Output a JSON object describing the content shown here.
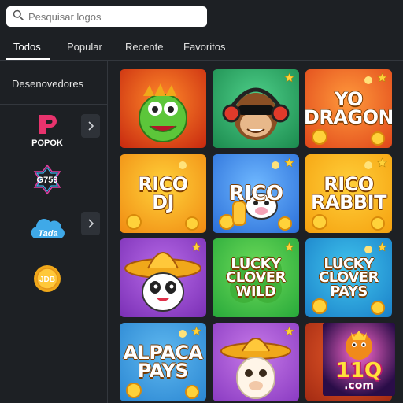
{
  "search": {
    "placeholder": "Pesquisar logos"
  },
  "tabs": [
    {
      "label": "Todos",
      "active": true
    },
    {
      "label": "Popular",
      "active": false
    },
    {
      "label": "Recente",
      "active": false
    },
    {
      "label": "Favoritos",
      "active": false
    }
  ],
  "sidebar": {
    "title": "Desenovedores",
    "providers": [
      {
        "name": "POPOK",
        "icon": "popok-logo"
      },
      {
        "name": "G759",
        "icon": "g759-logo"
      },
      {
        "name": "Tada",
        "icon": "tada-cloud-logo"
      },
      {
        "name": "JDB",
        "icon": "jdb-coin-logo"
      }
    ]
  },
  "games": [
    {
      "title": "",
      "art": "green-dragon",
      "bg": [
        "#ff8a2a",
        "#c7280f"
      ],
      "favorite": false
    },
    {
      "title": "",
      "art": "monkey-headphones",
      "bg": [
        "#4fd08a",
        "#1b8a4e"
      ],
      "favorite": true
    },
    {
      "title": "YO\nDRAGON",
      "art": "coins",
      "bg": [
        "#ff9a3c",
        "#e0461a"
      ],
      "favorite": true
    },
    {
      "title": "RICO\nDJ",
      "art": "coins",
      "bg": [
        "#ffd23a",
        "#f08a12"
      ],
      "favorite": false
    },
    {
      "title": "RICO",
      "art": "cow-coins",
      "bg": [
        "#6fb8ff",
        "#2a6ed8"
      ],
      "favorite": true
    },
    {
      "title": "RICO\nRABBIT",
      "art": "coins",
      "bg": [
        "#ffcf3a",
        "#f5a10f"
      ],
      "favorite": true
    },
    {
      "title": "",
      "art": "panda-sombrero",
      "bg": [
        "#b86be8",
        "#7a2fb5"
      ],
      "favorite": true
    },
    {
      "title": "LUCKY\nCLOVER\nWILD",
      "art": "clover",
      "bg": [
        "#6fdc5a",
        "#27a83a"
      ],
      "favorite": true
    },
    {
      "title": "LUCKY\nCLOVER\nPAYS",
      "art": "coins",
      "bg": [
        "#41c6ee",
        "#1a7fc8"
      ],
      "favorite": true
    },
    {
      "title": "ALPACA\nPAYS",
      "art": "coins",
      "bg": [
        "#5fb8ef",
        "#2a86d2"
      ],
      "favorite": true
    },
    {
      "title": "",
      "art": "llama-sombrero",
      "bg": [
        "#c77ae8",
        "#8a3bc2"
      ],
      "favorite": true
    },
    {
      "title": "",
      "art": "hidden",
      "bg": [
        "#e65a2a",
        "#a32a12"
      ],
      "favorite": false
    }
  ],
  "overlay": {
    "brand": "11Q",
    "domain": ".com"
  },
  "colors": {
    "background": "#1d2024",
    "divider": "#33373d",
    "button": "#2e3238"
  }
}
